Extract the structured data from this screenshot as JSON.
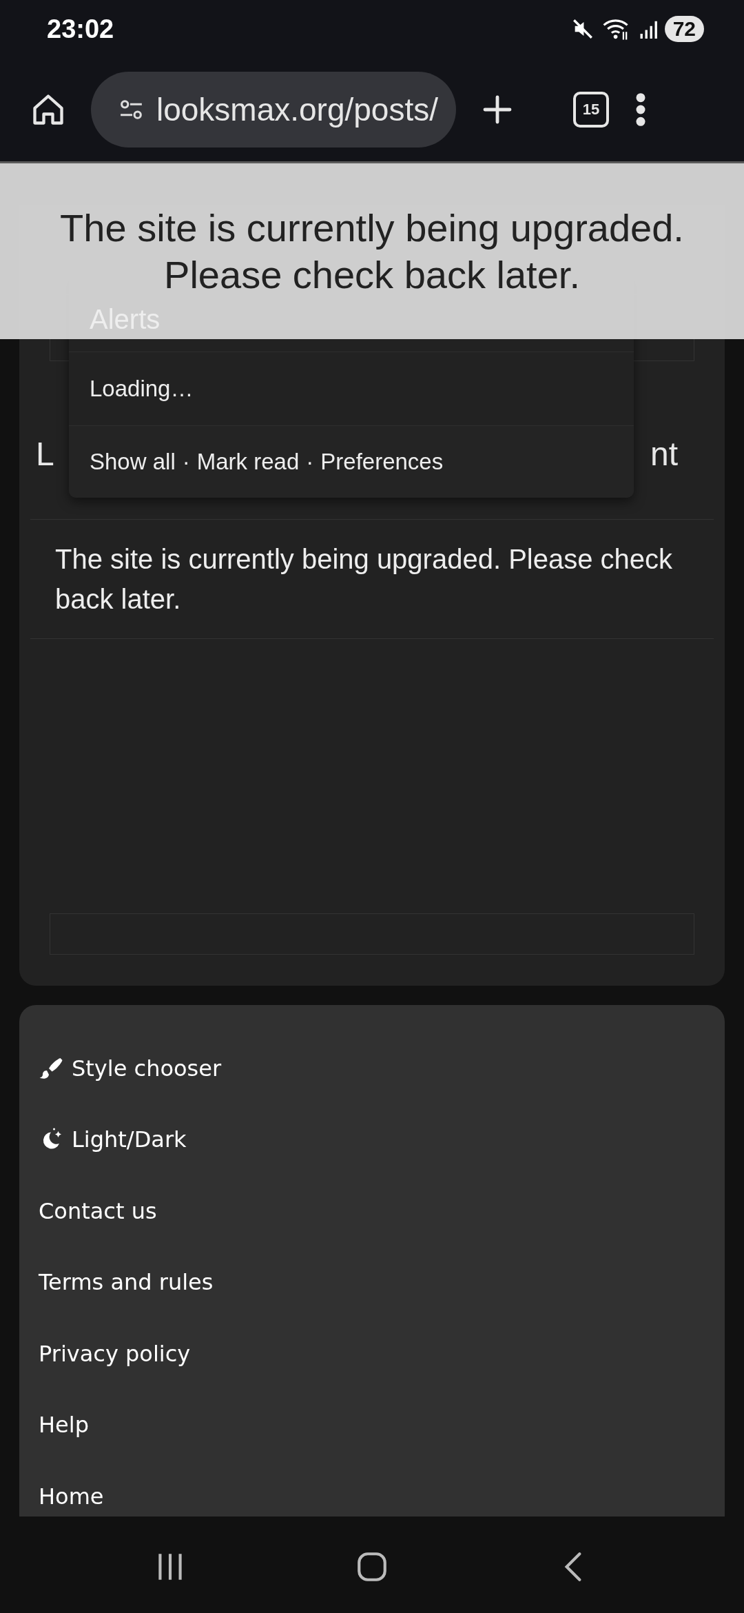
{
  "status_bar": {
    "time": "23:02",
    "battery": "72"
  },
  "browser": {
    "url": "looksmax.org/posts/",
    "tab_count": "15"
  },
  "banner": {
    "text": "The site is currently being upgraded. Please check back later."
  },
  "alerts_menu": {
    "title": "Alerts",
    "status": "Loading…",
    "footer_links": [
      "Show all",
      "Mark read",
      "Preferences"
    ],
    "separator": "·"
  },
  "page": {
    "title_fragments": [
      "L",
      "nt"
    ],
    "message": "The site is currently being upgraded. Please check back later."
  },
  "footer": {
    "items": [
      {
        "kind": "style",
        "label": "Style chooser"
      },
      {
        "kind": "theme",
        "label": "Light/Dark"
      },
      {
        "kind": "link",
        "label": "Contact us"
      },
      {
        "kind": "link",
        "label": "Terms and rules"
      },
      {
        "kind": "link",
        "label": "Privacy policy"
      },
      {
        "kind": "link",
        "label": "Help"
      },
      {
        "kind": "link",
        "label": "Home"
      }
    ]
  }
}
